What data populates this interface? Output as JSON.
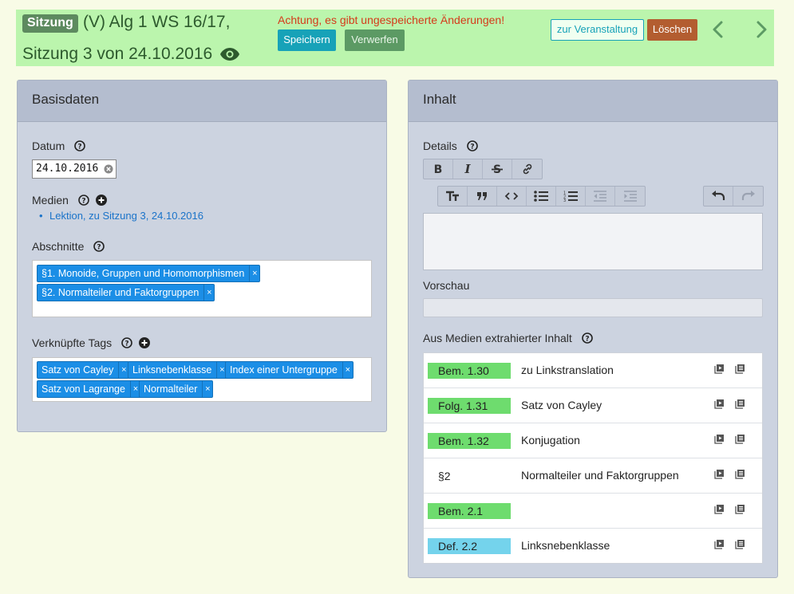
{
  "header": {
    "badge": "Sitzung",
    "title_line1": "(V) Alg 1 WS 16/17,",
    "title_line2": "Sitzung 3 von 24.10.2016",
    "warning": "Achtung, es gibt ungespeicherte Änderungen!",
    "save_label": "Speichern",
    "discard_label": "Verwerfen",
    "event_label": "zur Veranstaltung",
    "delete_label": "Löschen"
  },
  "basis": {
    "title": "Basisdaten",
    "date_label": "Datum",
    "date_value": "24.10.2016",
    "media_label": "Medien",
    "media_items": [
      "Lektion, zu Sitzung 3, 24.10.2016"
    ],
    "sections_label": "Abschnitte",
    "sections": [
      "§1. Monoide, Gruppen und Homomorphismen",
      "§2. Normalteiler und Faktorgruppen"
    ],
    "tags_label": "Verknüpfte Tags",
    "tags": [
      "Satz von Cayley",
      "Linksnebenklasse",
      "Index einer Untergruppe",
      "Satz von Lagrange",
      "Normalteiler"
    ],
    "remove_glyph": "×"
  },
  "content": {
    "title": "Inhalt",
    "details_label": "Details",
    "preview_label": "Vorschau",
    "extracted_label": "Aus Medien extrahierter Inhalt",
    "items": [
      {
        "badge": "Bem. 1.30",
        "title": "zu Linkstranslation",
        "kind": "green"
      },
      {
        "badge": "Folg. 1.31",
        "title": "Satz von Cayley",
        "kind": "green"
      },
      {
        "badge": "Bem. 1.32",
        "title": "Konjugation",
        "kind": "green"
      },
      {
        "badge": "§2",
        "title": "Normalteiler und Faktorgruppen",
        "kind": "none"
      },
      {
        "badge": "Bem. 2.1",
        "title": "",
        "kind": "green"
      },
      {
        "badge": "Def. 2.2",
        "title": "Linksnebenklasse",
        "kind": "blue"
      }
    ]
  },
  "colors": {
    "header_bg": "#bbf5ad",
    "badge_green": "#6edc6e",
    "badge_blue": "#74d3ec",
    "tag_blue": "#1b8ee6",
    "link": "#1a73c9",
    "warning": "#d53a1a"
  },
  "icons": {
    "toolbar_row1": [
      "bold-icon",
      "italic-icon",
      "strikethrough-icon",
      "link-icon"
    ],
    "toolbar_row2": [
      "heading-icon",
      "quote-icon",
      "code-icon",
      "bullet-list-icon",
      "numbered-list-icon",
      "outdent-icon",
      "indent-icon"
    ],
    "toolbar_row3": [
      "undo-icon",
      "redo-icon"
    ],
    "row_icons": [
      "play-media-icon",
      "document-icon"
    ]
  }
}
